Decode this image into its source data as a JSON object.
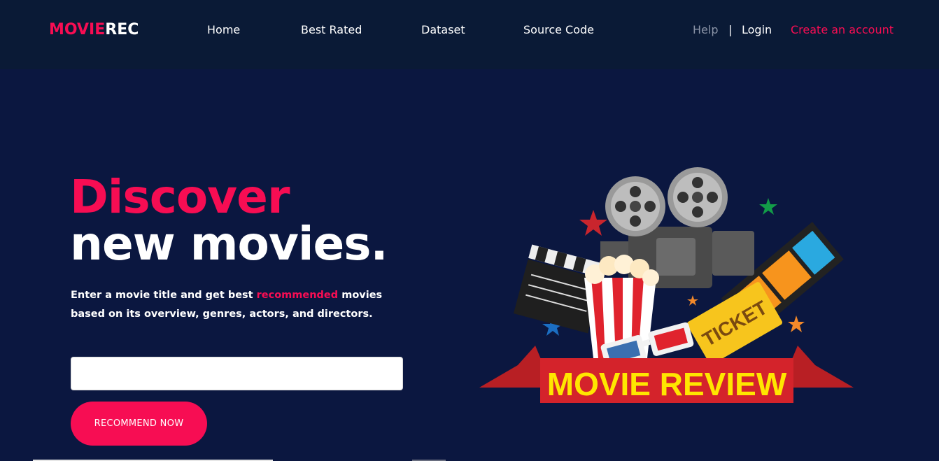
{
  "nav": {
    "logo_part1": "MOVIE",
    "logo_part2": "REC",
    "links": [
      "Home",
      "Best Rated",
      "Dataset",
      "Source Code"
    ],
    "help": "Help",
    "separator": "|",
    "login": "Login",
    "create_account": "Create an account"
  },
  "hero": {
    "headline_line1": "Discover",
    "headline_line2": "new movies.",
    "sub_before": "Enter a movie title and get best ",
    "sub_highlight": "recommended",
    "sub_after": " movies based on its overview, genres, actors, and directors.",
    "search_value": "",
    "button_label": "RECOMMEND NOW"
  },
  "illustration": {
    "banner_text": "MOVIE REVIEW",
    "ticket_text": "TICKET"
  },
  "colors": {
    "accent": "#f70d53",
    "navbar_bg": "#0a1a36",
    "page_bg": "#0b1740"
  }
}
